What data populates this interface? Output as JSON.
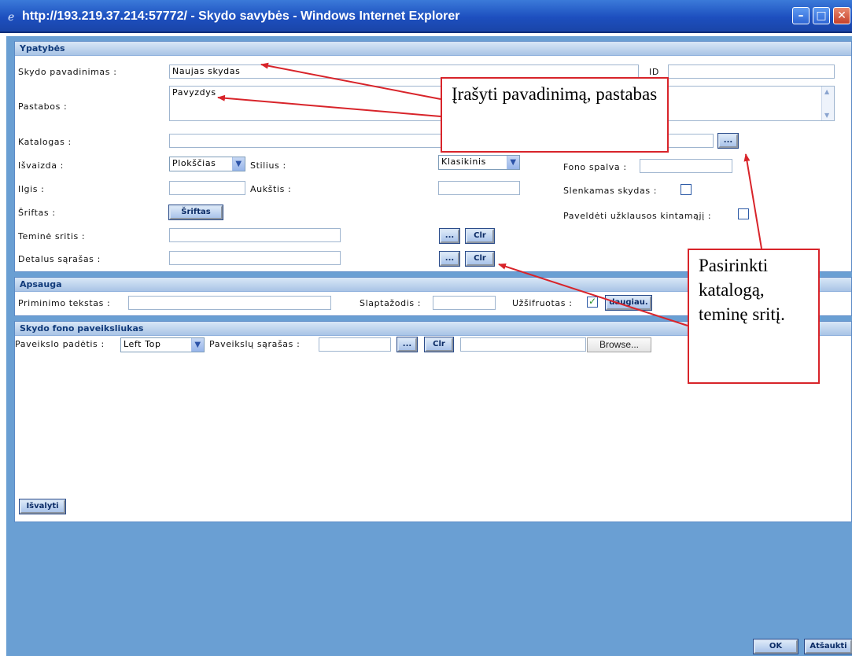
{
  "window": {
    "title": "http://193.219.37.214:57772/ - Skydo savybės - Windows Internet Explorer",
    "icon": "ie-icon",
    "buttons": [
      "minimize",
      "maximize",
      "close"
    ]
  },
  "ypatybes": {
    "header": "Ypatybės",
    "name_label": "Skydo pavadinimas :",
    "name_value": "Naujas skydas",
    "id_label": "ID",
    "id_value": "",
    "notes_label": "Pastabos :",
    "notes_value": "Pavyzdys",
    "catalog_label": "Katalogas :",
    "catalog_value": "",
    "catalog_button": "...",
    "view_label": "Išvaizda :",
    "view_value": "Plokščias",
    "style_label": "Stilius :",
    "style_value": "Klasikinis",
    "bg_color_label": "Fono spalva :",
    "bg_color_value": "",
    "length_label": "Ilgis :",
    "length_value": "",
    "height_label": "Aukštis :",
    "height_value": "",
    "scroll_label": "Slenkamas skydas :",
    "scroll_checked": false,
    "font_label": "Šriftas :",
    "font_button": "Šriftas",
    "inherit_label": "Paveldėti užklausos kintamąjį :",
    "inherit_checked": false,
    "topic_label": "Teminė sritis :",
    "topic_value": "",
    "detail_label": "Detalus sąrašas :",
    "detail_value": "",
    "dots_button": "...",
    "clr_button": "Clr"
  },
  "apsauga": {
    "header": "Apsauga",
    "reminder_label": "Priminimo tekstas :",
    "reminder_value": "",
    "password_label": "Slaptažodis :",
    "password_value": "",
    "encrypted_label": "Užšifruotas :",
    "encrypted_checked": true,
    "more_button": "daugiau."
  },
  "fonas": {
    "header": "Skydo fono paveiksliukas",
    "position_label": "Paveikslo padėtis :",
    "position_value": "Left Top",
    "list_label": "Paveikslų sąrašas :",
    "list_value": "",
    "dots_button": "...",
    "clr_button": "Clr",
    "file_value": "",
    "browse_button": "Browse...",
    "clear_button": "Išvalyti"
  },
  "footer": {
    "ok_button": "OK",
    "cancel_button": "Atšaukti"
  },
  "callouts": {
    "top": "Įrašyti pavadinimą, pastabas",
    "right": "Pasirinkti katalogą, teminę sritį."
  },
  "colors": {
    "titlebar": "#1d4fbf",
    "dialog_bg": "#6a9fd3",
    "section_header_text": "#103a7a",
    "arrow": "#d8242a"
  }
}
